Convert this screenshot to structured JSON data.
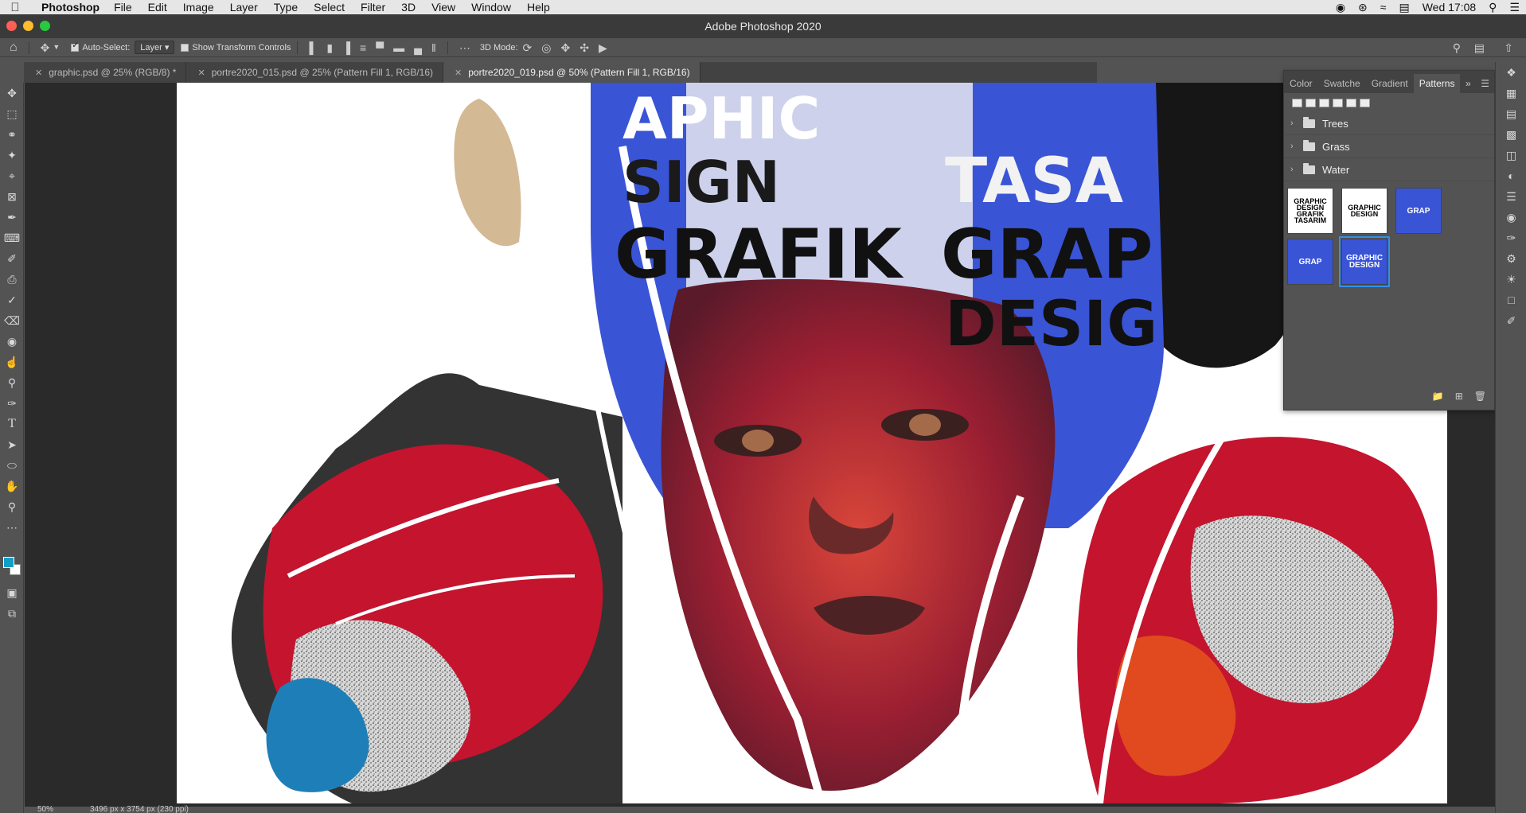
{
  "menubar": {
    "app_name": "Photoshop",
    "items": [
      "File",
      "Edit",
      "Image",
      "Layer",
      "Type",
      "Select",
      "Filter",
      "3D",
      "View",
      "Window",
      "Help"
    ],
    "clock": "Wed 17:08"
  },
  "window": {
    "title": "Adobe Photoshop 2020"
  },
  "options_bar": {
    "auto_select_label": "Auto-Select:",
    "auto_select_value": "Layer",
    "transform_label": "Show Transform Controls",
    "mode_3d_label": "3D Mode:"
  },
  "tabs": [
    {
      "label": "graphic.psd @ 25% (RGB/8) *"
    },
    {
      "label": "portre2020_015.psd @ 25% (Pattern Fill 1, RGB/16)"
    },
    {
      "label": "portre2020_019.psd @ 50% (Pattern Fill 1, RGB/16)"
    }
  ],
  "patterns_panel": {
    "tabs": [
      "Color",
      "Swatche",
      "Gradient",
      "Patterns"
    ],
    "groups": [
      "Trees",
      "Grass",
      "Water"
    ],
    "swatch_texts": [
      "GRAPHIC DESIGN GRAFIK TASARIM",
      "GRAPHIC DESIGN",
      "GRAP",
      "GRAP",
      "GRAPHIC DESIGN"
    ]
  },
  "status": {
    "zoom": "50%",
    "doc_info": "3496 px x 3754 px (230 ppi)"
  },
  "artwork": {
    "poster_words": [
      "APHIC",
      "SIGN",
      "GRAFIK",
      "GRAP",
      "DESIG",
      "TASA"
    ]
  },
  "colors": {
    "foreground": "#10a0c6",
    "background": "#ffffff",
    "accent_blue": "#3a54d6",
    "selection": "#2e8ff0"
  }
}
